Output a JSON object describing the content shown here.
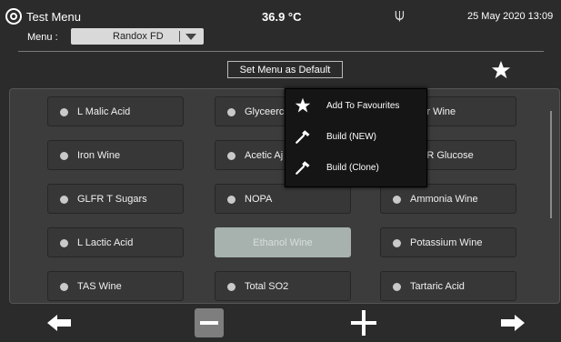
{
  "header": {
    "title": "Test Menu",
    "temperature": "36.9 °C",
    "datetime": "25 May 2020 13:09",
    "menu_label": "Menu :",
    "menu_value": "Randox FD",
    "icons": [
      "logo-icon",
      "usb-icon",
      "chevron-down-icon"
    ]
  },
  "toolbar": {
    "set_default_label": "Set Menu as Default",
    "favourites_icon": "star-icon"
  },
  "tests": [
    {
      "label": "L Malic Acid"
    },
    {
      "label": "Glyceerce"
    },
    {
      "label": "pper Wine"
    },
    {
      "label": "Iron Wine"
    },
    {
      "label": "Acetic Aj"
    },
    {
      "label": "GIFR Glucose"
    },
    {
      "label": "GLFR T Sugars"
    },
    {
      "label": "NOPA"
    },
    {
      "label": "Ammonia Wine"
    },
    {
      "label": "L Lactic Acid"
    },
    {
      "label": "Ethanol Wine"
    },
    {
      "label": "Potassium Wine"
    },
    {
      "label": "TAS Wine"
    },
    {
      "label": "Total SO2"
    },
    {
      "label": "Tartaric Acid"
    }
  ],
  "context_menu": {
    "items": [
      {
        "label": "Add To Favourites",
        "icon": "star-icon"
      },
      {
        "label": "Build (NEW)",
        "icon": "hammer-icon"
      },
      {
        "label": "Build (Clone)",
        "icon": "hammer-icon"
      }
    ]
  },
  "bottom_bar": {
    "icons": [
      "arrow-left-icon",
      "minus-icon",
      "plus-icon",
      "arrow-right-icon"
    ]
  },
  "colors": {
    "background": "#2b2b2b",
    "panel": "#3c3c3c",
    "selected_tile": "#a7b2ae",
    "popup": "#151515"
  }
}
